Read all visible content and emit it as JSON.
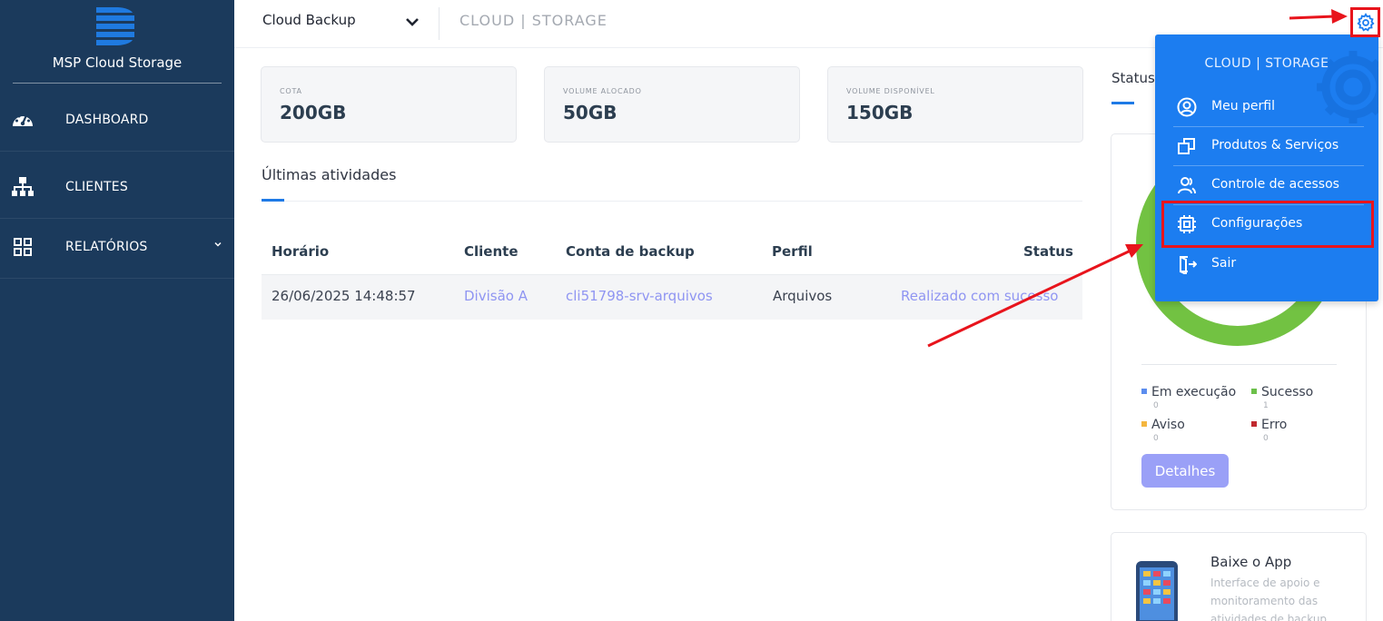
{
  "sidebar": {
    "brand": "MSP Cloud Storage",
    "items": [
      {
        "label": "DASHBOARD",
        "icon": "dashboard-gauge-icon"
      },
      {
        "label": "CLIENTES",
        "icon": "org-chart-icon"
      },
      {
        "label": "RELATÓRIOS",
        "icon": "grid-icon"
      }
    ]
  },
  "topbar": {
    "product": "Cloud Backup",
    "brand": "CLOUD | STORAGE"
  },
  "stats": [
    {
      "label": "COTA",
      "value": "200GB"
    },
    {
      "label": "VOLUME ALOCADO",
      "value": "50GB"
    },
    {
      "label": "VOLUME DISPONÍVEL",
      "value": "150GB"
    }
  ],
  "activities": {
    "title": "Últimas atividades",
    "columns": [
      "Horário",
      "Cliente",
      "Conta de backup",
      "Perfil",
      "Status"
    ],
    "rows": [
      {
        "time": "26/06/2025 14:48:57",
        "client": "Divisão A",
        "account": "cli51798-srv-arquivos",
        "profile": "Arquivos",
        "status": "Realizado com sucesso"
      }
    ]
  },
  "status_panel": {
    "title": "Status",
    "legend": [
      {
        "label": "Em execução",
        "count": "0",
        "color": "#5b8def"
      },
      {
        "label": "Sucesso",
        "count": "1",
        "color": "#6cc04a"
      },
      {
        "label": "Aviso",
        "count": "0",
        "color": "#f4b63f"
      },
      {
        "label": "Erro",
        "count": "0",
        "color": "#c0292f"
      }
    ],
    "details_button": "Detalhes"
  },
  "app_card": {
    "title": "Baixe o App",
    "description": "Interface de apoio e monitoramento das atividades de backup"
  },
  "menu": {
    "header": "CLOUD | STORAGE",
    "items": [
      {
        "label": "Meu perfil",
        "icon": "user-circle-icon"
      },
      {
        "label": "Produtos & Serviços",
        "icon": "copy-squares-icon"
      },
      {
        "label": "Controle de acessos",
        "icon": "users-icon"
      },
      {
        "label": "Configurações",
        "icon": "chip-icon"
      },
      {
        "label": "Sair",
        "icon": "logout-icon"
      }
    ]
  },
  "colors": {
    "sidebar": "#1b3a5c",
    "accent": "#1e7ae6",
    "menu": "#1c7df0",
    "success": "#6cc04a",
    "link": "#8f95f2",
    "annotation": "#e8141c"
  }
}
